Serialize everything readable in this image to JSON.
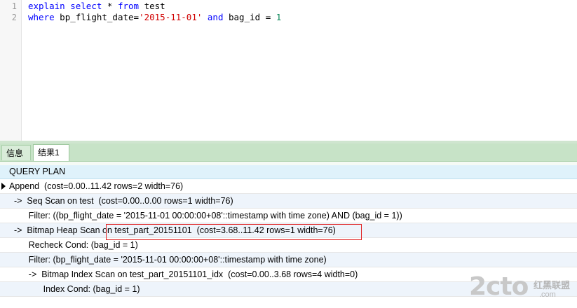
{
  "editor": {
    "line_numbers": [
      "1",
      "2"
    ],
    "line1": {
      "kw1": "explain",
      "kw2": "select",
      "rest1": " * ",
      "kw3": "from",
      "rest2": " test"
    },
    "line2": {
      "kw1": "where",
      "rest1": " bp_flight_date=",
      "str1": "'2015-11-01'",
      "sp": " ",
      "kw2": "and",
      "rest2": " bag_id = ",
      "num1": "1"
    }
  },
  "tabs": [
    {
      "label": "信息"
    },
    {
      "label": "结果1"
    }
  ],
  "grid": {
    "column": "QUERY PLAN",
    "rows": [
      "Append  (cost=0.00..11.42 rows=2 width=76)",
      "  ->  Seq Scan on test  (cost=0.00..0.00 rows=1 width=76)",
      "        Filter: ((bp_flight_date = '2015-11-01 00:00:00+08'::timestamp with time zone) AND (bag_id = 1))",
      "  ->  Bitmap Heap Scan on test_part_20151101  (cost=3.68..11.42 rows=1 width=76)",
      "        Recheck Cond: (bag_id = 1)",
      "        Filter: (bp_flight_date = '2015-11-01 00:00:00+08'::timestamp with time zone)",
      "        ->  Bitmap Index Scan on test_part_20151101_idx  (cost=0.00..3.68 rows=4 width=0)",
      "              Index Cond: (bag_id = 1)"
    ]
  },
  "watermark": {
    "logo": "2cto",
    "cn": "红黑联盟",
    "domain": ".com"
  }
}
